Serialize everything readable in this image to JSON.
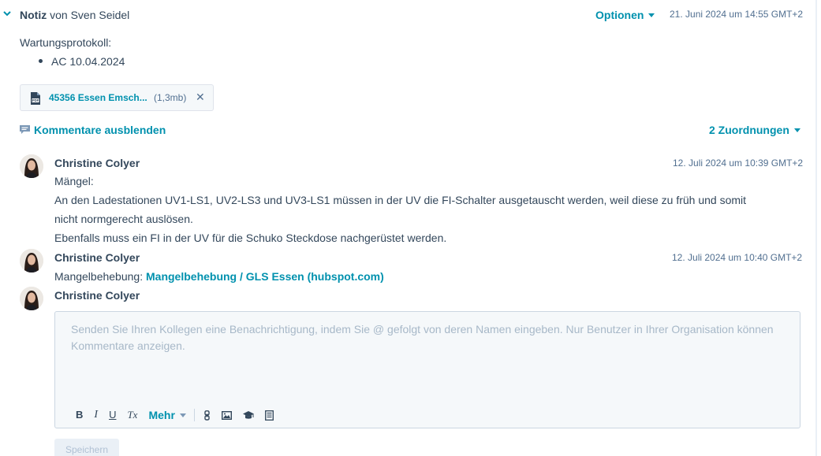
{
  "note": {
    "type_label": "Notiz",
    "by_text": "von Sven Seidel",
    "options_label": "Optionen",
    "date": "21. Juni 2024 um 14:55 GMT+2",
    "body_heading": "Wartungsprotokoll:",
    "bullets": [
      "AC 10.04.2024"
    ]
  },
  "attachment": {
    "file_name": "45356 Essen Emsch...",
    "file_size": "(1,3mb)",
    "remove_glyph": "✕",
    "icon": "pdf-file-icon"
  },
  "comments_toggle_label": "Kommentare ausblenden",
  "associations_label": "2 Zuordnungen",
  "comments": [
    {
      "author": "Christine Colyer",
      "date": "12. Juli 2024 um 10:39 GMT+2",
      "lines": [
        "Mängel:",
        "An den Ladestationen UV1-LS1, UV2-LS3 und UV3-LS1 müssen in der UV die FI-Schalter ausgetauscht werden, weil diese zu früh und somit",
        "nicht normgerecht auslösen.",
        "Ebenfalls muss ein FI in der UV für die Schuko Steckdose nachgerüstet werden."
      ]
    },
    {
      "author": "Christine Colyer",
      "date": "12. Juli 2024 um 10:40 GMT+2",
      "prefix": "Mangelbehebung:",
      "link_text": "Mangelbehebung / GLS Essen (hubspot.com)"
    }
  ],
  "composer": {
    "author": "Christine Colyer",
    "placeholder": "Senden Sie Ihren Kollegen eine Benachrichtigung, indem Sie @ gefolgt von deren Namen eingeben. Nur Benutzer in Ihrer Organisation können Kommentare anzeigen.",
    "toolbar": {
      "bold": "B",
      "italic": "I",
      "underline": "U",
      "clear_format": "Tx",
      "more": "Mehr"
    },
    "save_label": "Speichern"
  },
  "colors": {
    "accent": "#0091ae",
    "text": "#33475b",
    "muted": "#516f90",
    "panel": "#f5f8fa"
  }
}
